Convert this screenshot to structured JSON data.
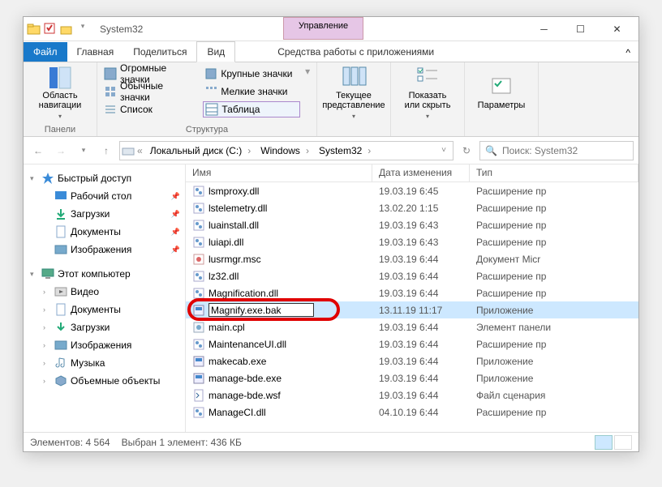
{
  "window": {
    "title": "System32",
    "manage_label": "Управление"
  },
  "tabs": {
    "file": "Файл",
    "home": "Главная",
    "share": "Поделиться",
    "view": "Вид",
    "tools": "Средства работы с приложениями"
  },
  "ribbon": {
    "nav_pane": "Область\nнавигации",
    "panels": "Панели",
    "xl_icons": "Огромные значки",
    "l_icons": "Крупные значки",
    "m_icons": "Обычные значки",
    "s_icons": "Мелкие значки",
    "list": "Список",
    "table": "Таблица",
    "layout": "Структура",
    "curr_view": "Текущее\nпредставление",
    "show_hide": "Показать\nили скрыть",
    "options": "Параметры"
  },
  "address": {
    "crumbs": [
      "Локальный диск (C:)",
      "Windows",
      "System32"
    ],
    "search_placeholder": "Поиск: System32"
  },
  "tree": {
    "quick": "Быстрый доступ",
    "desktop": "Рабочий стол",
    "downloads": "Загрузки",
    "documents": "Документы",
    "pictures": "Изображения",
    "thispc": "Этот компьютер",
    "videos": "Видео",
    "tdocuments": "Документы",
    "tdownloads": "Загрузки",
    "tpictures": "Изображения",
    "music": "Музыка",
    "objects3d": "Объемные объекты"
  },
  "columns": {
    "name": "Имя",
    "date": "Дата изменения",
    "type": "Тип"
  },
  "files": [
    {
      "name": "lsmproxy.dll",
      "date": "19.03.19 6:45",
      "type": "Расширение пр",
      "icon": "dll"
    },
    {
      "name": "lstelemetry.dll",
      "date": "13.02.20 1:15",
      "type": "Расширение пр",
      "icon": "dll"
    },
    {
      "name": "luainstall.dll",
      "date": "19.03.19 6:43",
      "type": "Расширение пр",
      "icon": "dll"
    },
    {
      "name": "luiapi.dll",
      "date": "19.03.19 6:43",
      "type": "Расширение пр",
      "icon": "dll"
    },
    {
      "name": "lusrmgr.msc",
      "date": "19.03.19 6:44",
      "type": "Документ Micr",
      "icon": "msc"
    },
    {
      "name": "lz32.dll",
      "date": "19.03.19 6:44",
      "type": "Расширение пр",
      "icon": "dll"
    },
    {
      "name": "Magnification.dll",
      "date": "19.03.19 6:44",
      "type": "Расширение пр",
      "icon": "dll"
    },
    {
      "name": "Magnify.exe.bak",
      "date": "13.11.19 11:17",
      "type": "Приложение",
      "icon": "exe",
      "rename": true
    },
    {
      "name": "main.cpl",
      "date": "19.03.19 6:44",
      "type": "Элемент панели",
      "icon": "cpl"
    },
    {
      "name": "MaintenanceUI.dll",
      "date": "19.03.19 6:44",
      "type": "Расширение пр",
      "icon": "dll"
    },
    {
      "name": "makecab.exe",
      "date": "19.03.19 6:44",
      "type": "Приложение",
      "icon": "exe"
    },
    {
      "name": "manage-bde.exe",
      "date": "19.03.19 6:44",
      "type": "Приложение",
      "icon": "exe"
    },
    {
      "name": "manage-bde.wsf",
      "date": "19.03.19 6:44",
      "type": "Файл сценария",
      "icon": "wsf"
    },
    {
      "name": "ManageCI.dll",
      "date": "04.10.19 6:44",
      "type": "Расширение пр",
      "icon": "dll"
    }
  ],
  "status": {
    "count_label": "Элементов:",
    "count": "4 564",
    "sel_label": "Выбран 1 элемент:",
    "sel_size": "436 КБ"
  }
}
